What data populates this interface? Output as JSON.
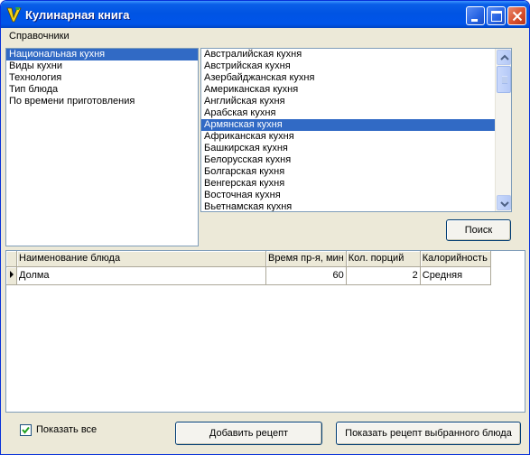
{
  "window": {
    "title": "Кулинарная книга",
    "accent": "#0054e3"
  },
  "menu": {
    "items": [
      "Справочники"
    ]
  },
  "categories": {
    "selected_index": 0,
    "items": [
      "Национальная кухня",
      "Виды кухни",
      "Технология",
      "Тип блюда",
      "По времени приготовления"
    ]
  },
  "values": {
    "selected_index": 6,
    "items": [
      "Австралийская кухня",
      "Австрийская кухня",
      "Азербайджанская кухня",
      "Американская кухня",
      "Английская кухня",
      "Арабская кухня",
      "Армянская кухня",
      "Африканская кухня",
      "Башкирская кухня",
      "Белорусская кухня",
      "Болгарская кухня",
      "Венгерская кухня",
      "Восточная кухня",
      "Вьетнамская кухня"
    ]
  },
  "search_button": "Поиск",
  "grid": {
    "columns": [
      "Наименование блюда",
      "Время пр-я, мин",
      "Кол. порций",
      "Калорийность"
    ],
    "rows": [
      [
        "Долма",
        "60",
        "2",
        "Средняя"
      ]
    ]
  },
  "footer": {
    "show_all_label": "Показать все",
    "show_all_checked": true,
    "add_recipe_button": "Добавить рецепт",
    "show_recipe_button": "Показать рецепт выбранного блюда"
  }
}
